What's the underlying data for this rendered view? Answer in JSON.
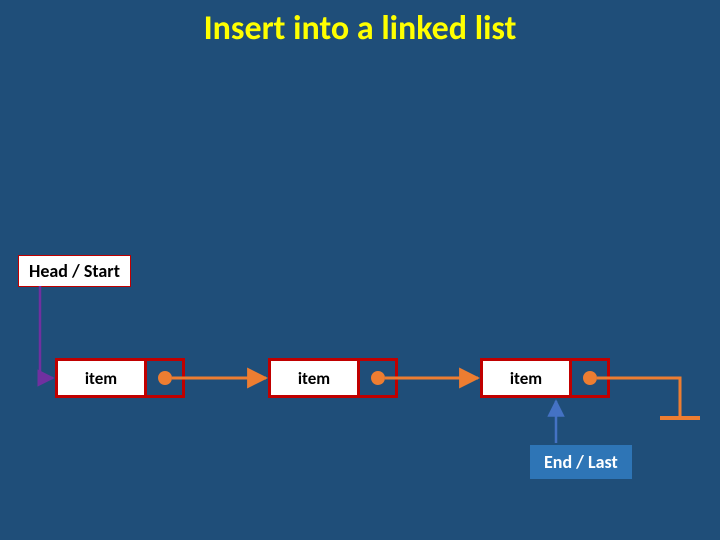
{
  "title": "Insert into a linked list",
  "labels": {
    "head": "Head / Start",
    "end": "End / Last"
  },
  "nodes": [
    {
      "text": "item"
    },
    {
      "text": "item"
    },
    {
      "text": "item"
    }
  ],
  "colors": {
    "background": "#1f4e79",
    "title": "#ffff00",
    "node_border": "#c00000",
    "pointer": "#ed7d31",
    "end_box": "#2e75b6",
    "end_arrow": "#4472c4",
    "head_arrow": "#7030a0"
  },
  "chart_data": {
    "type": "table",
    "description": "Singly linked list diagram with three nodes. 'Head / Start' points to first node. Each node's pointer cell points to the next node. Third node's pointer goes to a ground/terminator. 'End / Last' label points at the third node.",
    "nodes": [
      "item",
      "item",
      "item"
    ],
    "head_points_to_index": 0,
    "next": [
      1,
      2,
      "null/ground"
    ],
    "end_label_points_to_index": 2
  }
}
